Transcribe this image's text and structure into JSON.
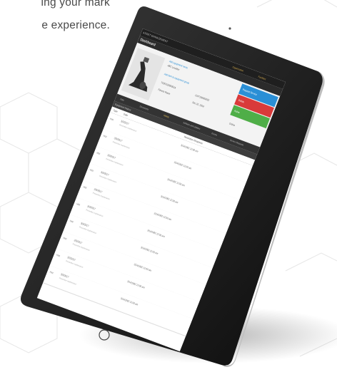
{
  "headline": {
    "line1": "ing your mark",
    "line2": "e experience."
  },
  "tablet_screen": {
    "app_title": "ASSET MANAGEMENT",
    "page_title": "Dashboard",
    "nav_items": [
      "Organization",
      "Facilities"
    ],
    "equipment": {
      "name": "Add equipment name",
      "location": "ABC Location",
      "group_link": "Add item to equipment group",
      "serial": "TCBT01800001A",
      "model": "CW7100000002",
      "facility": "Fitness Room",
      "date": "Dec 10, 2019"
    },
    "actions": [
      {
        "label": "Request Service",
        "color": "#2a8fd6"
      },
      {
        "label": "Delete",
        "color": "#d93a3a"
      },
      {
        "label": "Active",
        "color": "#4fae48"
      }
    ],
    "status": {
      "label": "Online"
    },
    "tabs": [
      "Data",
      "Documents",
      "History",
      "Software and Updates",
      "Events",
      "Service Requests"
    ],
    "active_tab": 2,
    "section_title": "Equipment History",
    "columns": [
      "Type",
      "Date",
      "Resolution Response"
    ],
    "rows": [
      {
        "type": "Hist",
        "date": "3/3/2017",
        "sub": "Preventive maintenance",
        "resp": "3/14/1982 12:00 am"
      },
      {
        "type": "Hist",
        "date": "3/3/2017",
        "sub": "Preventive maintenance",
        "resp": "3/14/1982 12:00 am"
      },
      {
        "type": "Hist",
        "date": "3/3/2017",
        "sub": "Preventive maintenance",
        "resp": "3/14/1982 12:00 am"
      },
      {
        "type": "Hist",
        "date": "3/3/2017",
        "sub": "Preventive maintenance",
        "resp": "3/14/1982 12:00 am"
      },
      {
        "type": "Hist",
        "date": "3/3/2017",
        "sub": "Preventive maintenance",
        "resp": "3/14/1982 12:00 am"
      },
      {
        "type": "Hist",
        "date": "3/3/2017",
        "sub": "Preventive maintenance",
        "resp": "3/14/1982 12:00 am"
      },
      {
        "type": "Hist",
        "date": "3/3/2017",
        "sub": "Preventive maintenance",
        "resp": "3/14/1982 12:00 am"
      },
      {
        "type": "Hist",
        "date": "3/3/2017",
        "sub": "Preventive maintenance",
        "resp": "3/14/1982 12:00 am"
      },
      {
        "type": "Hist",
        "date": "3/3/2017",
        "sub": "Preventive maintenance",
        "resp": "3/14/1982 12:00 am"
      },
      {
        "type": "Hist",
        "date": "3/3/2017",
        "sub": "Preventive maintenance",
        "resp": "3/14/1982 12:00 am"
      }
    ]
  }
}
